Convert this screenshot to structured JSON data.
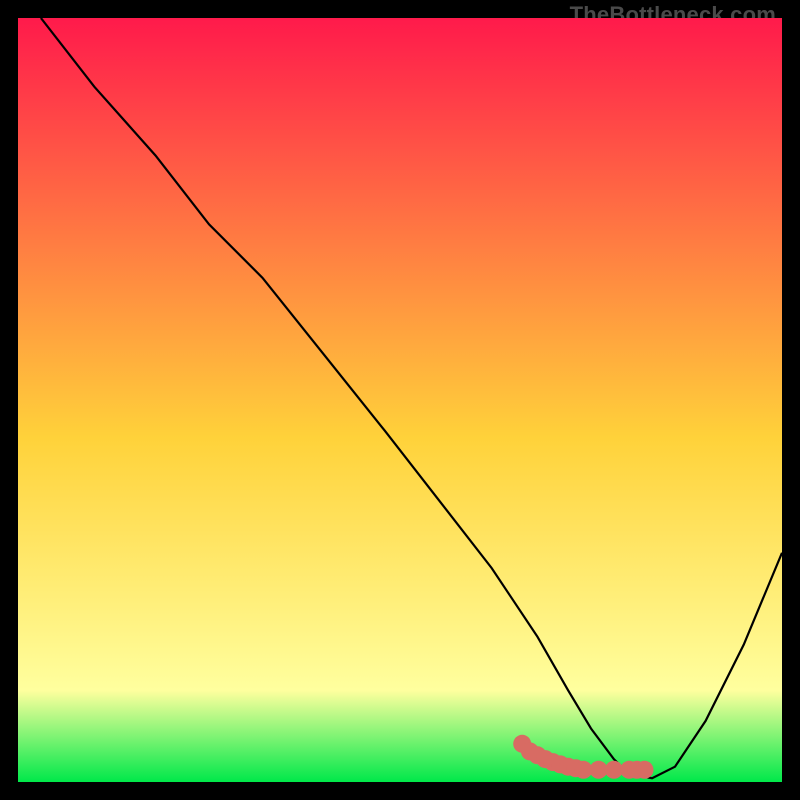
{
  "watermark": "TheBottleneck.com",
  "colors": {
    "gradient_top": "#ff1a4b",
    "gradient_mid": "#ffd23a",
    "gradient_low": "#ffff9e",
    "gradient_bottom": "#00e84a",
    "curve": "#000000",
    "marker": "#d86b63",
    "frame_bg": "#ffffff",
    "page_bg": "#000000"
  },
  "chart_data": {
    "type": "line",
    "title": "",
    "xlabel": "",
    "ylabel": "",
    "xlim": [
      0,
      100
    ],
    "ylim": [
      0,
      100
    ],
    "grid": false,
    "legend": false,
    "series": [
      {
        "name": "bottleneck-curve",
        "x": [
          3,
          10,
          18,
          25,
          32,
          40,
          48,
          55,
          62,
          68,
          72,
          75,
          78,
          80,
          83,
          86,
          90,
          95,
          100
        ],
        "y": [
          100,
          91,
          82,
          73,
          66,
          56,
          46,
          37,
          28,
          19,
          12,
          7,
          3,
          1,
          0.5,
          2,
          8,
          18,
          30
        ]
      }
    ],
    "markers": {
      "name": "highlight-region",
      "x": [
        66,
        67,
        68,
        69,
        70,
        71,
        72,
        73,
        74,
        76,
        78,
        80,
        81,
        82
      ],
      "y": [
        5,
        4,
        3.5,
        3,
        2.6,
        2.3,
        2.0,
        1.8,
        1.6,
        1.6,
        1.6,
        1.6,
        1.6,
        1.6
      ]
    }
  }
}
